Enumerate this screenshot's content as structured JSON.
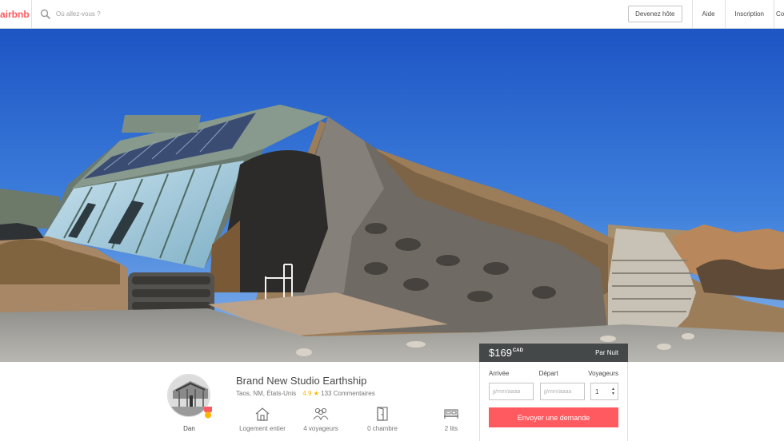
{
  "header": {
    "logo": "airbnb",
    "search_placeholder": "Où allez-vous ?",
    "host_button": "Devenez hôte",
    "nav": [
      "Aide",
      "Inscription",
      "Connexion"
    ]
  },
  "booking": {
    "price": "$169",
    "currency": "CAD",
    "per_night": "Par Nuit",
    "arrival_label": "Arrivée",
    "departure_label": "Départ",
    "guests_label": "Voyageurs",
    "date_placeholder": "jj/mm/aaaa",
    "guests_value": "1",
    "request_button": "Envoyer une demande"
  },
  "listing": {
    "title": "Brand New Studio Earthship",
    "location": "Taos, NM, États-Unis",
    "rating": "4.9",
    "star": "★",
    "reviews": "133 Commentaires",
    "host_name": "Dan",
    "amenities": [
      {
        "icon": "house-icon",
        "label": "Logement entier"
      },
      {
        "icon": "guests-icon",
        "label": "4 voyageurs"
      },
      {
        "icon": "door-icon",
        "label": "0 chambre"
      },
      {
        "icon": "bed-icon",
        "label": "2 lits"
      }
    ]
  },
  "colors": {
    "brand": "#ff5a5f",
    "star": "#ffb400",
    "price_bar": "#3c3f40"
  }
}
